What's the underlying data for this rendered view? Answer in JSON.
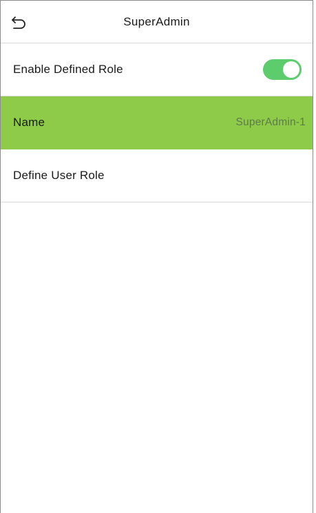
{
  "header": {
    "title": "SuperAdmin",
    "back_icon": "back-arrow-icon"
  },
  "rows": {
    "enable_defined_role": {
      "label": "Enable Defined Role",
      "toggle_on": true
    },
    "name": {
      "label": "Name",
      "value": "SuperAdmin-1",
      "selected": true
    },
    "define_user_role": {
      "label": "Define User Role"
    }
  },
  "colors": {
    "accent_green": "#8ecb48",
    "toggle_green": "#5ccc6d",
    "divider": "#d9d9d9"
  }
}
